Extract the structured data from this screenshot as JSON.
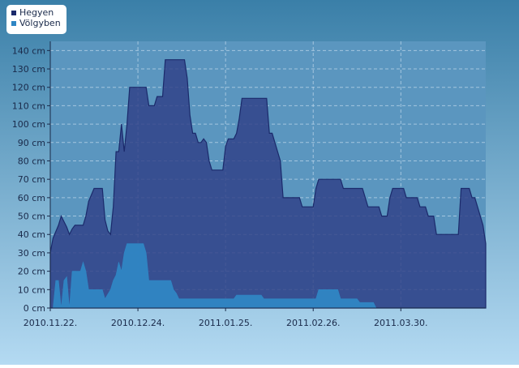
{
  "colors": {
    "background_top": "#3a7fa8",
    "background_bottom": "#b4daf2",
    "plot_background": "#5b96bf",
    "hegyen_fill": "#2f3f86",
    "hegyen_line": "#1b2a6b",
    "volgyben_fill": "#2f86c4",
    "grid": "#bcd6ea",
    "text": "#1a2a4a",
    "legend_background": "#ffffff"
  },
  "chart_data": {
    "type": "area",
    "title": "",
    "xlabel": "",
    "ylabel": "",
    "y_unit": "cm",
    "ylim": [
      0,
      145
    ],
    "grid": true,
    "legend_placement": "top-left",
    "x_range": [
      "2010-11-22",
      "2011-04-30"
    ],
    "x_ticks": [
      "2010-11-22",
      "2010-12-24",
      "2011-01-25",
      "2011-02-26",
      "2011-03-30"
    ],
    "x_tick_labels": [
      "2010.11.22.",
      "2010.12.24.",
      "2011.01.25.",
      "2011.02.26.",
      "2011.03.30."
    ],
    "y_ticks": [
      0,
      10,
      20,
      30,
      40,
      50,
      60,
      70,
      80,
      90,
      100,
      110,
      120,
      130,
      140
    ],
    "y_tick_labels": [
      "0 cm",
      "10 cm",
      "20 cm",
      "30 cm",
      "40 cm",
      "50 cm",
      "60 cm",
      "70 cm",
      "80 cm",
      "90 cm",
      "100 cm",
      "110 cm",
      "120 cm",
      "130 cm",
      "140 cm"
    ],
    "series": [
      {
        "name": "Hegyen",
        "points": [
          [
            "2010-11-22",
            30
          ],
          [
            "2010-11-23",
            38
          ],
          [
            "2010-11-25",
            45
          ],
          [
            "2010-11-26",
            50
          ],
          [
            "2010-11-28",
            44
          ],
          [
            "2010-11-29",
            40
          ],
          [
            "2010-11-30",
            43
          ],
          [
            "2010-12-01",
            45
          ],
          [
            "2010-12-04",
            45
          ],
          [
            "2010-12-05",
            50
          ],
          [
            "2010-12-06",
            58
          ],
          [
            "2010-12-08",
            65
          ],
          [
            "2010-12-11",
            65
          ],
          [
            "2010-12-12",
            48
          ],
          [
            "2010-12-13",
            42
          ],
          [
            "2010-12-14",
            40
          ],
          [
            "2010-12-15",
            55
          ],
          [
            "2010-12-16",
            85
          ],
          [
            "2010-12-17",
            85
          ],
          [
            "2010-12-18",
            100
          ],
          [
            "2010-12-19",
            85
          ],
          [
            "2010-12-20",
            100
          ],
          [
            "2010-12-21",
            120
          ],
          [
            "2010-12-27",
            120
          ],
          [
            "2010-12-28",
            110
          ],
          [
            "2010-12-30",
            110
          ],
          [
            "2010-12-31",
            115
          ],
          [
            "2011-01-02",
            115
          ],
          [
            "2011-01-03",
            135
          ],
          [
            "2011-01-10",
            135
          ],
          [
            "2011-01-11",
            125
          ],
          [
            "2011-01-12",
            105
          ],
          [
            "2011-01-13",
            95
          ],
          [
            "2011-01-14",
            95
          ],
          [
            "2011-01-15",
            90
          ],
          [
            "2011-01-16",
            90
          ],
          [
            "2011-01-17",
            92
          ],
          [
            "2011-01-18",
            90
          ],
          [
            "2011-01-19",
            80
          ],
          [
            "2011-01-20",
            75
          ],
          [
            "2011-01-24",
            75
          ],
          [
            "2011-01-25",
            88
          ],
          [
            "2011-01-26",
            92
          ],
          [
            "2011-01-28",
            92
          ],
          [
            "2011-01-29",
            95
          ],
          [
            "2011-01-30",
            103
          ],
          [
            "2011-01-31",
            114
          ],
          [
            "2011-02-09",
            114
          ],
          [
            "2011-02-10",
            95
          ],
          [
            "2011-02-11",
            95
          ],
          [
            "2011-02-14",
            80
          ],
          [
            "2011-02-15",
            60
          ],
          [
            "2011-02-21",
            60
          ],
          [
            "2011-02-22",
            55
          ],
          [
            "2011-02-26",
            55
          ],
          [
            "2011-02-27",
            65
          ],
          [
            "2011-02-28",
            70
          ],
          [
            "2011-03-08",
            70
          ],
          [
            "2011-03-09",
            65
          ],
          [
            "2011-03-16",
            65
          ],
          [
            "2011-03-18",
            55
          ],
          [
            "2011-03-22",
            55
          ],
          [
            "2011-03-23",
            50
          ],
          [
            "2011-03-25",
            50
          ],
          [
            "2011-03-26",
            60
          ],
          [
            "2011-03-27",
            65
          ],
          [
            "2011-03-31",
            65
          ],
          [
            "2011-04-01",
            60
          ],
          [
            "2011-04-05",
            60
          ],
          [
            "2011-04-06",
            55
          ],
          [
            "2011-04-08",
            55
          ],
          [
            "2011-04-09",
            50
          ],
          [
            "2011-04-11",
            50
          ],
          [
            "2011-04-12",
            40
          ],
          [
            "2011-04-20",
            40
          ],
          [
            "2011-04-21",
            65
          ],
          [
            "2011-04-24",
            65
          ],
          [
            "2011-04-25",
            60
          ],
          [
            "2011-04-26",
            60
          ],
          [
            "2011-04-27",
            55
          ],
          [
            "2011-04-29",
            45
          ],
          [
            "2011-04-30",
            35
          ]
        ]
      },
      {
        "name": "Völgyben",
        "points": [
          [
            "2010-11-22",
            0
          ],
          [
            "2010-11-23",
            0
          ],
          [
            "2010-11-24",
            15
          ],
          [
            "2010-11-25",
            15
          ],
          [
            "2010-11-26",
            0
          ],
          [
            "2010-11-27",
            15
          ],
          [
            "2010-11-28",
            17
          ],
          [
            "2010-11-29",
            0
          ],
          [
            "2010-11-30",
            20
          ],
          [
            "2010-12-03",
            20
          ],
          [
            "2010-12-04",
            25
          ],
          [
            "2010-12-05",
            20
          ],
          [
            "2010-12-06",
            10
          ],
          [
            "2010-12-11",
            10
          ],
          [
            "2010-12-12",
            5
          ],
          [
            "2010-12-14",
            10
          ],
          [
            "2010-12-15",
            15
          ],
          [
            "2010-12-16",
            18
          ],
          [
            "2010-12-17",
            25
          ],
          [
            "2010-12-18",
            20
          ],
          [
            "2010-12-19",
            30
          ],
          [
            "2010-12-20",
            35
          ],
          [
            "2010-12-26",
            35
          ],
          [
            "2010-12-27",
            30
          ],
          [
            "2010-12-28",
            15
          ],
          [
            "2011-01-05",
            15
          ],
          [
            "2011-01-06",
            10
          ],
          [
            "2011-01-07",
            8
          ],
          [
            "2011-01-08",
            5
          ],
          [
            "2011-01-28",
            5
          ],
          [
            "2011-01-29",
            7
          ],
          [
            "2011-02-07",
            7
          ],
          [
            "2011-02-08",
            5
          ],
          [
            "2011-02-27",
            5
          ],
          [
            "2011-02-28",
            10
          ],
          [
            "2011-03-07",
            10
          ],
          [
            "2011-03-08",
            5
          ],
          [
            "2011-03-14",
            5
          ],
          [
            "2011-03-15",
            3
          ],
          [
            "2011-03-20",
            3
          ],
          [
            "2011-03-21",
            0
          ],
          [
            "2011-04-30",
            0
          ]
        ]
      }
    ]
  }
}
